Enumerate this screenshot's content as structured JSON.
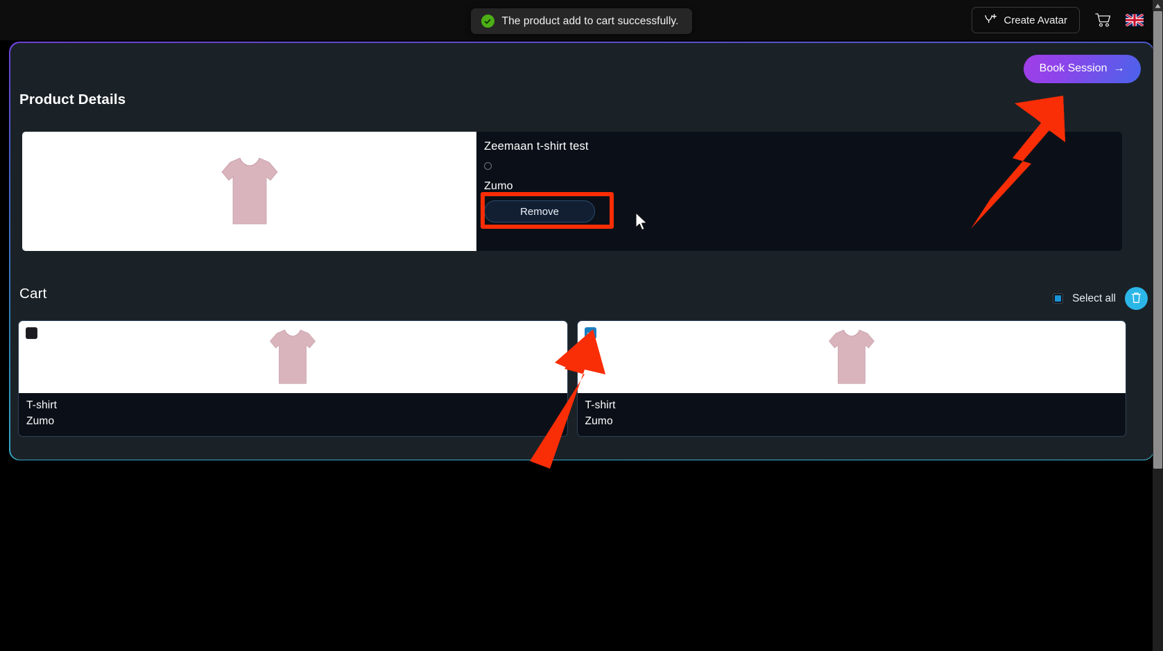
{
  "topbar": {
    "toast": {
      "message": "The product add to cart successfully.",
      "icon": "check-circle-icon",
      "color": "#4caf16"
    },
    "create_avatar_label": "Create Avatar",
    "create_avatar_icon": "avatar-plus-icon",
    "cart_icon": "shopping-cart-icon",
    "language_flag": "uk-flag-icon"
  },
  "panel": {
    "book_session_label": "Book Session",
    "book_session_arrow": "→",
    "gradient_start": "#a13ee8",
    "gradient_end": "#4a63ea",
    "border_gradient_top": "#6b3fd4",
    "border_gradient_bottom": "#3fb6d4"
  },
  "product_details": {
    "heading": "Product Details",
    "product_name": "Zeemaan t-shirt test",
    "color_swatch": "empty-color-circle",
    "brand": "Zumo",
    "remove_label": "Remove",
    "image_alt": "pink-tshirt-image",
    "shirt_color": "#d9b4bc"
  },
  "cart": {
    "heading": "Cart",
    "select_all_label": "Select all",
    "select_all_state": "indeterminate",
    "delete_icon": "trash-icon",
    "delete_button_color": "#2bb6e8",
    "items": [
      {
        "name": "T-shirt",
        "brand": "Zumo",
        "checked": false,
        "image_alt": "pink-tshirt-image"
      },
      {
        "name": "T-shirt",
        "brand": "Zumo",
        "checked": true,
        "image_alt": "pink-tshirt-image"
      }
    ]
  },
  "annotations": {
    "highlight_color": "#f92d06",
    "box_target": "remove-button",
    "arrow_1_target": "book-session-button",
    "arrow_2_target": "cart-item-2-checkbox"
  }
}
